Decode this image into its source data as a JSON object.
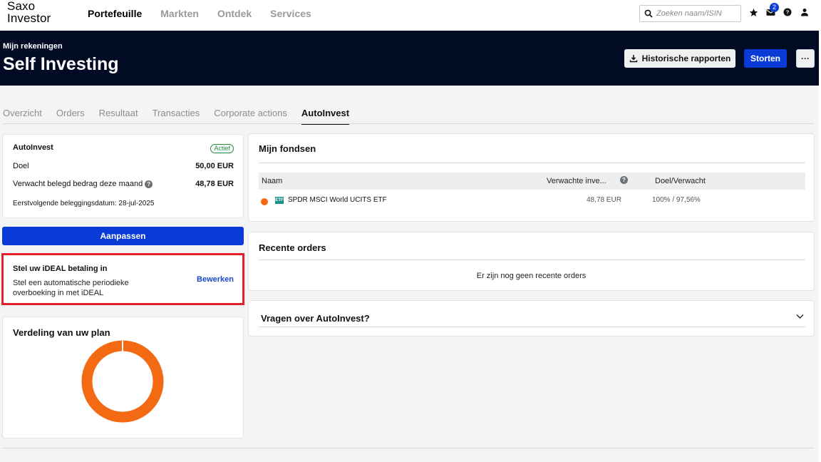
{
  "brand": {
    "line1": "Saxo",
    "line2": "Investor"
  },
  "nav": [
    {
      "label": "Portefeuille",
      "active": true
    },
    {
      "label": "Markten",
      "active": false
    },
    {
      "label": "Ontdek",
      "active": false
    },
    {
      "label": "Services",
      "active": false
    }
  ],
  "search": {
    "placeholder": "Zoeken naam/ISIN",
    "value": ""
  },
  "top_icons": {
    "star": "star-icon",
    "mail": "mail-icon",
    "mail_badge": "2",
    "help": "help-icon",
    "user": "user-icon"
  },
  "header": {
    "subtitle": "Mijn rekeningen",
    "title": "Self Investing",
    "hist_button": "Historische rapporten",
    "storten_button": "Storten",
    "more_button": "···"
  },
  "tabs": [
    {
      "label": "Overzicht",
      "active": false
    },
    {
      "label": "Orders",
      "active": false
    },
    {
      "label": "Resultaat",
      "active": false
    },
    {
      "label": "Transacties",
      "active": false
    },
    {
      "label": "Corporate actions",
      "active": false
    },
    {
      "label": "AutoInvest",
      "active": true
    }
  ],
  "autoinvest": {
    "title": "AutoInvest",
    "status": "Actief",
    "goal_label": "Doel",
    "goal_value": "50,00 EUR",
    "expected_label": "Verwacht belegd bedrag deze maand",
    "expected_value": "48,78 EUR",
    "next_date": "Eerstvolgende beleggingsdatum: 28-jul-2025",
    "adjust_button": "Aanpassen"
  },
  "ideal": {
    "title": "Stel uw iDEAL betaling in",
    "description": "Stel een automatische periodieke overboeking in met iDEAL",
    "edit_link": "Bewerken"
  },
  "distribution": {
    "title": "Verdeling van uw plan",
    "slices": [
      {
        "name": "SPDR MSCI World UCITS ETF",
        "fraction": 1.0,
        "color": "#f46a12"
      }
    ]
  },
  "funds": {
    "title": "Mijn fondsen",
    "columns": {
      "name": "Naam",
      "expected": "Verwachte inve...",
      "target": "Doel/Verwacht"
    },
    "rows": [
      {
        "name": "SPDR MSCI World UCITS ETF",
        "badge": "ETF",
        "expected": "48,78 EUR",
        "target": "100% / 97,56%",
        "color": "#f46a12"
      }
    ]
  },
  "orders": {
    "title": "Recente orders",
    "empty": "Er zijn nog geen recente orders"
  },
  "faq": {
    "title": "Vragen over AutoInvest?"
  }
}
